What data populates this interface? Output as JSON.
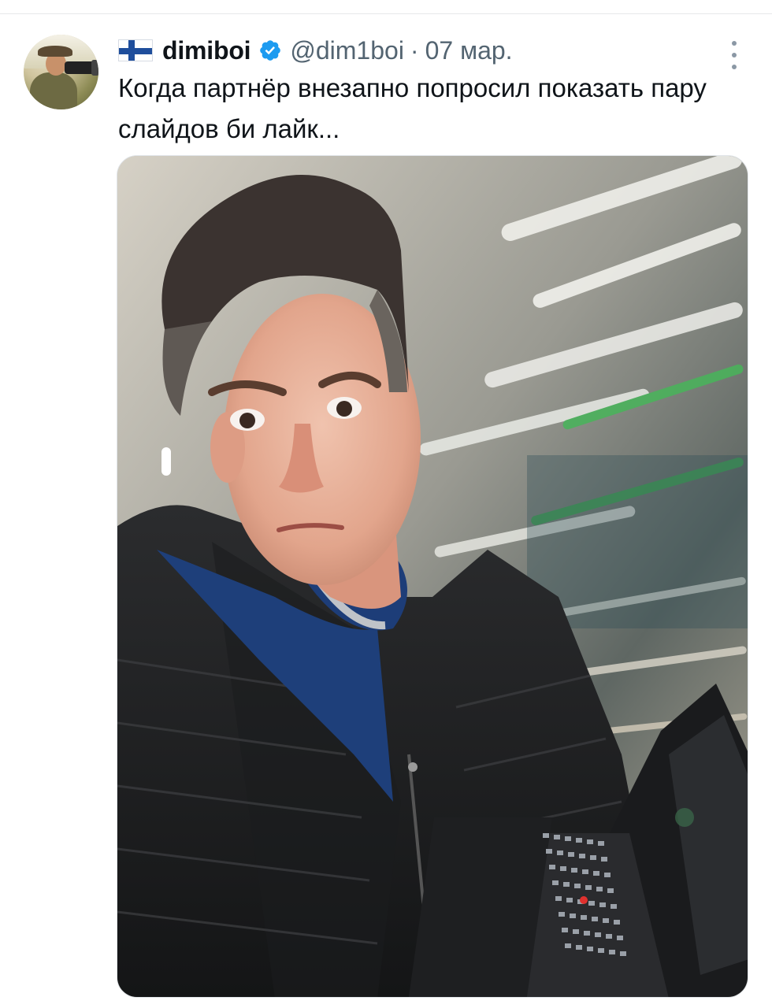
{
  "tweet": {
    "author": {
      "display_name": "dimiboi",
      "handle": "@dim1boi",
      "flag": "finland-flag",
      "verified": true,
      "avatar_icon": "photographer-avatar"
    },
    "separator": "·",
    "date": "07 мар.",
    "text": "Когда партнёр внезапно попросил показать пару слайдов би лайк...",
    "media_icon": "selfie-photo-man-with-laptop",
    "menu_icon": "more-options-icon"
  },
  "colors": {
    "text_primary": "#0f1419",
    "text_secondary": "#536471",
    "verified_blue": "#1d9bf0",
    "finland_blue": "#1f4e9c"
  }
}
